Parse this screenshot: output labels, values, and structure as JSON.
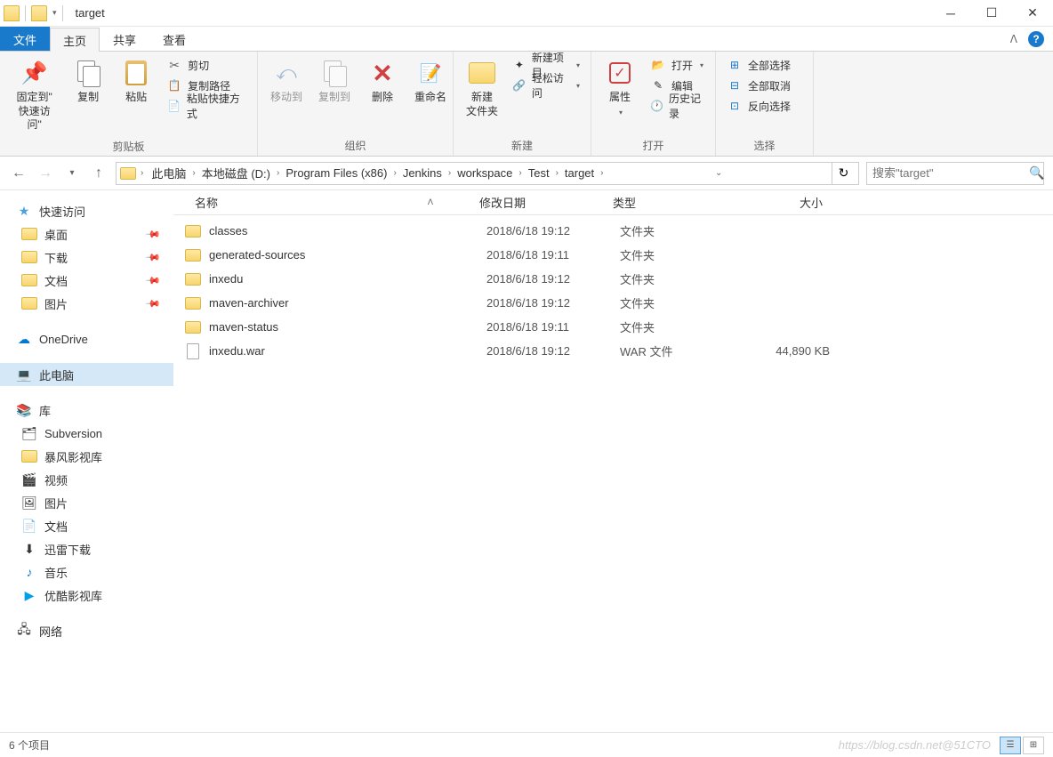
{
  "window": {
    "title": "target"
  },
  "tabs": {
    "file": "文件",
    "home": "主页",
    "share": "共享",
    "view": "查看"
  },
  "ribbon": {
    "clipboard": {
      "label": "剪贴板",
      "pin": "固定到\"\n快速访问\"",
      "copy": "复制",
      "paste": "粘贴",
      "cut": "剪切",
      "copy_path": "复制路径",
      "paste_shortcut": "粘贴快捷方式"
    },
    "organize": {
      "label": "组织",
      "move_to": "移动到",
      "copy_to": "复制到",
      "delete": "删除",
      "rename": "重命名"
    },
    "new": {
      "label": "新建",
      "new_folder": "新建\n文件夹",
      "new_item": "新建项目",
      "easy_access": "轻松访问"
    },
    "open": {
      "label": "打开",
      "properties": "属性",
      "open": "打开",
      "edit": "编辑",
      "history": "历史记录"
    },
    "select": {
      "label": "选择",
      "select_all": "全部选择",
      "select_none": "全部取消",
      "invert_selection": "反向选择"
    }
  },
  "breadcrumb": [
    "此电脑",
    "本地磁盘 (D:)",
    "Program Files (x86)",
    "Jenkins",
    "workspace",
    "Test",
    "target"
  ],
  "search_placeholder": "搜索\"target\"",
  "nav": {
    "quick_access": "快速访问",
    "desktop": "桌面",
    "downloads": "下载",
    "documents": "文档",
    "pictures": "图片",
    "onedrive": "OneDrive",
    "this_pc": "此电脑",
    "library": "库",
    "subversion": "Subversion",
    "storm": "暴风影视库",
    "video": "视频",
    "pictures2": "图片",
    "documents2": "文档",
    "xunlei": "迅雷下载",
    "music": "音乐",
    "youku": "优酷影视库",
    "network": "网络"
  },
  "columns": {
    "name": "名称",
    "date": "修改日期",
    "type": "类型",
    "size": "大小"
  },
  "files": [
    {
      "icon": "folder",
      "name": "classes",
      "date": "2018/6/18 19:12",
      "type": "文件夹",
      "size": ""
    },
    {
      "icon": "folder",
      "name": "generated-sources",
      "date": "2018/6/18 19:11",
      "type": "文件夹",
      "size": ""
    },
    {
      "icon": "folder",
      "name": "inxedu",
      "date": "2018/6/18 19:12",
      "type": "文件夹",
      "size": ""
    },
    {
      "icon": "folder",
      "name": "maven-archiver",
      "date": "2018/6/18 19:12",
      "type": "文件夹",
      "size": ""
    },
    {
      "icon": "folder",
      "name": "maven-status",
      "date": "2018/6/18 19:11",
      "type": "文件夹",
      "size": ""
    },
    {
      "icon": "file",
      "name": "inxedu.war",
      "date": "2018/6/18 19:12",
      "type": "WAR 文件",
      "size": "44,890 KB"
    }
  ],
  "status": {
    "count": "6 个项目",
    "watermark": "https://blog.csdn.net@51CTO"
  }
}
